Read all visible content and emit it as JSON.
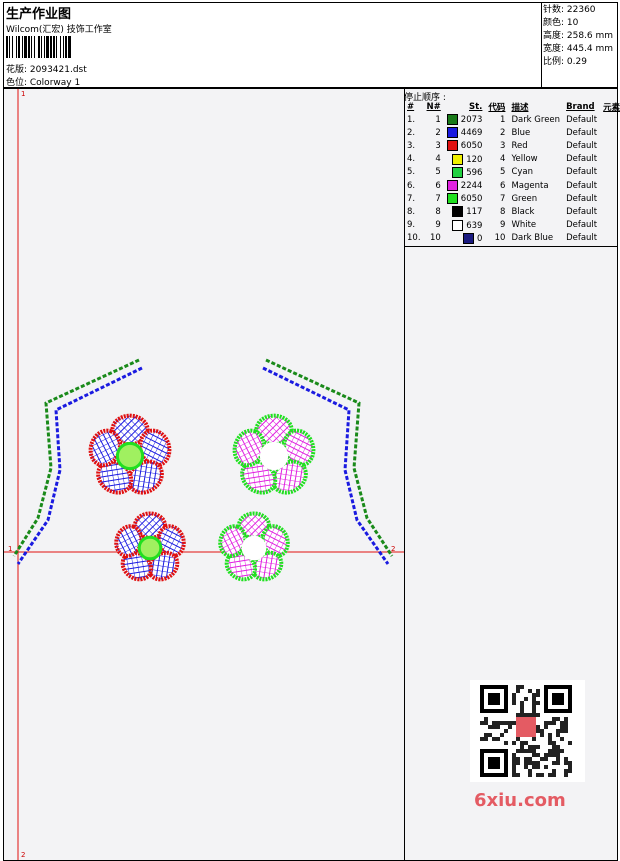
{
  "header": {
    "title": "生产作业图",
    "subtitle": "Wilcom(汇宏) 技饰工作室",
    "file_label": "花版: 2093421.dst",
    "colorway_label": "色位: Colorway 1"
  },
  "stats": {
    "stitches": "针数: 22360",
    "colors": "颜色: 10",
    "height": "高度: 258.6 mm",
    "width": "宽度: 445.4 mm",
    "scale": "比例: 0.29"
  },
  "sequence": {
    "title": "停止顺序 :",
    "headers": [
      "#",
      "N#",
      "St.",
      "代码",
      "描述",
      "Brand",
      "元素"
    ],
    "rows": [
      {
        "idx": "1.",
        "n": "1",
        "st": "2073",
        "code": "1",
        "desc": "Dark Green",
        "brand": "Default",
        "color": "#1a7a1a"
      },
      {
        "idx": "2.",
        "n": "2",
        "st": "4469",
        "code": "2",
        "desc": "Blue",
        "brand": "Default",
        "color": "#1a1ae0"
      },
      {
        "idx": "3.",
        "n": "3",
        "st": "6050",
        "code": "3",
        "desc": "Red",
        "brand": "Default",
        "color": "#e01010"
      },
      {
        "idx": "4.",
        "n": "4",
        "st": "120",
        "code": "4",
        "desc": "Yellow",
        "brand": "Default",
        "color": "#f0f000"
      },
      {
        "idx": "5.",
        "n": "5",
        "st": "596",
        "code": "5",
        "desc": "Cyan",
        "brand": "Default",
        "color": "#20d040"
      },
      {
        "idx": "6.",
        "n": "6",
        "st": "2244",
        "code": "6",
        "desc": "Magenta",
        "brand": "Default",
        "color": "#e020e0"
      },
      {
        "idx": "7.",
        "n": "7",
        "st": "6050",
        "code": "7",
        "desc": "Green",
        "brand": "Default",
        "color": "#20e020"
      },
      {
        "idx": "8.",
        "n": "8",
        "st": "117",
        "code": "8",
        "desc": "Black",
        "brand": "Default",
        "color": "#000000"
      },
      {
        "idx": "9.",
        "n": "9",
        "st": "639",
        "code": "9",
        "desc": "White",
        "brand": "Default",
        "color": "#ffffff"
      },
      {
        "idx": "10.",
        "n": "10",
        "st": "0",
        "code": "10",
        "desc": "Dark Blue",
        "brand": "Default",
        "color": "#1a1a80"
      }
    ]
  },
  "canvas": {
    "marker_1_top": "1",
    "marker_1_left": "1",
    "marker_2_right": "2",
    "marker_2_bottom": "2"
  },
  "watermark": "6xiu.com"
}
